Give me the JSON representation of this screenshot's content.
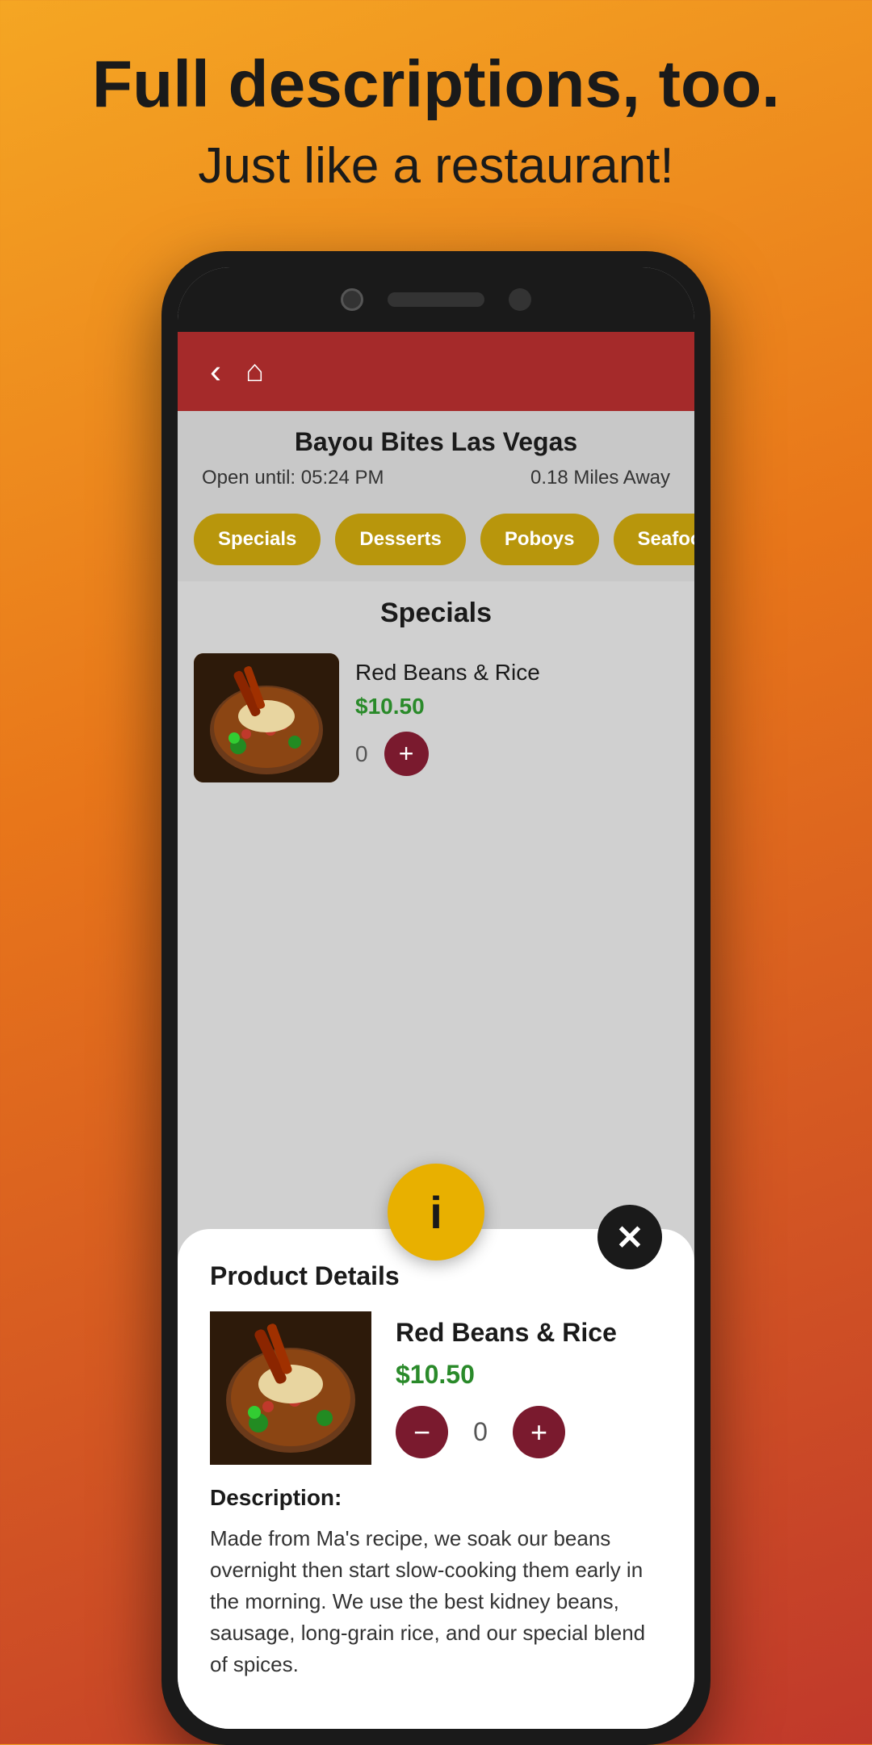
{
  "page": {
    "top_title": "Full descriptions, too.",
    "top_subtitle": "Just like a restaurant!"
  },
  "app": {
    "header": {
      "back_label": "‹",
      "home_label": "⌂"
    },
    "restaurant": {
      "name": "Bayou Bites Las Vegas",
      "open_until": "Open until: 05:24 PM",
      "distance": "0.18 Miles Away"
    },
    "categories": [
      {
        "id": "specials",
        "label": "Specials"
      },
      {
        "id": "desserts",
        "label": "Desserts"
      },
      {
        "id": "poboys",
        "label": "Poboys"
      },
      {
        "id": "seafood",
        "label": "Seafood"
      }
    ],
    "active_section": "Specials",
    "menu_item": {
      "name": "Red Beans & Rice",
      "price": "$10.50",
      "quantity": "0"
    },
    "info_icon": "i",
    "modal": {
      "title": "Product Details",
      "item_name": "Red Beans & Rice",
      "item_price": "$10.50",
      "quantity": "0",
      "description_label": "Description:",
      "description_text": "Made from Ma's recipe, we soak our beans overnight then start slow-cooking them early in the morning. We use the best kidney beans, sausage, long-grain rice, and our special blend of spices.",
      "close_label": "✕",
      "minus_label": "−",
      "plus_label": "+"
    }
  }
}
